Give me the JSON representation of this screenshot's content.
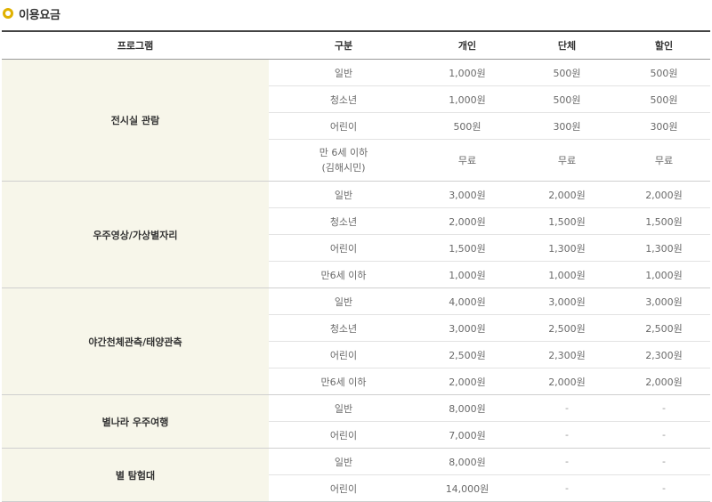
{
  "section": {
    "title": "이용요금",
    "icon": "circle-icon",
    "accent": "#e0b100"
  },
  "table": {
    "headers": [
      "프로그램",
      "구분",
      "개인",
      "단체",
      "할인"
    ],
    "groups": [
      {
        "program": "전시실 관람",
        "rows": [
          {
            "type": "일반",
            "individual": "1,000원",
            "group": "500원",
            "discount": "500원"
          },
          {
            "type": "청소년",
            "individual": "1,000원",
            "group": "500원",
            "discount": "500원"
          },
          {
            "type": "어린이",
            "individual": "500원",
            "group": "300원",
            "discount": "300원"
          },
          {
            "type": "만 6세 이하",
            "type_note": "(김해시민)",
            "individual": "무료",
            "group": "무료",
            "discount": "무료"
          }
        ]
      },
      {
        "program": "우주영상/가상별자리",
        "rows": [
          {
            "type": "일반",
            "individual": "3,000원",
            "group": "2,000원",
            "discount": "2,000원"
          },
          {
            "type": "청소년",
            "individual": "2,000원",
            "group": "1,500원",
            "discount": "1,500원"
          },
          {
            "type": "어린이",
            "individual": "1,500원",
            "group": "1,300원",
            "discount": "1,300원"
          },
          {
            "type": "만6세 이하",
            "individual": "1,000원",
            "group": "1,000원",
            "discount": "1,000원"
          }
        ]
      },
      {
        "program": "야간천체관측/태양관측",
        "rows": [
          {
            "type": "일반",
            "individual": "4,000원",
            "group": "3,000원",
            "discount": "3,000원"
          },
          {
            "type": "청소년",
            "individual": "3,000원",
            "group": "2,500원",
            "discount": "2,500원"
          },
          {
            "type": "어린이",
            "individual": "2,500원",
            "group": "2,300원",
            "discount": "2,300원"
          },
          {
            "type": "만6세 이하",
            "individual": "2,000원",
            "group": "2,000원",
            "discount": "2,000원"
          }
        ]
      },
      {
        "program": "별나라 우주여행",
        "rows": [
          {
            "type": "일반",
            "individual": "8,000원",
            "group": "-",
            "discount": "-"
          },
          {
            "type": "어린이",
            "individual": "7,000원",
            "group": "-",
            "discount": "-"
          }
        ]
      },
      {
        "program": "별 탐험대",
        "rows": [
          {
            "type": "일반",
            "individual": "8,000원",
            "group": "-",
            "discount": "-"
          },
          {
            "type": "어린이",
            "individual": "14,000원",
            "group": "-",
            "discount": "-"
          }
        ]
      }
    ]
  }
}
